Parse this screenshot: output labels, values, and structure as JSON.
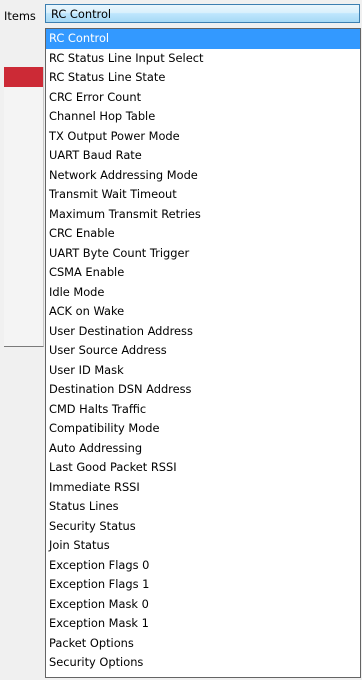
{
  "items_label": "Items",
  "combo": {
    "selected_value": "RC Control"
  },
  "colors": {
    "selection_background": "#3399ff",
    "selection_text": "#ffffff",
    "red_bar": "#cc2a36"
  },
  "dropdown": {
    "selected_index": 0,
    "options": [
      "RC Control",
      "RC Status Line Input Select",
      "RC Status Line State",
      "CRC Error Count",
      "Channel Hop Table",
      "TX Output Power Mode",
      "UART Baud Rate",
      "Network Addressing Mode",
      "Transmit Wait Timeout",
      "Maximum Transmit Retries",
      "CRC Enable",
      "UART Byte Count Trigger",
      "CSMA Enable",
      "Idle Mode",
      "ACK on Wake",
      "User Destination Address",
      "User Source Address",
      "User ID Mask",
      "Destination DSN Address",
      "CMD Halts Traffic",
      "Compatibility Mode",
      "Auto Addressing",
      "Last Good Packet RSSI",
      "Immediate RSSI",
      "Status Lines",
      "Security Status",
      "Join Status",
      "Exception Flags 0",
      "Exception Flags 1",
      "Exception Mask 0",
      "Exception Mask 1",
      "Packet Options",
      "Security Options"
    ]
  }
}
